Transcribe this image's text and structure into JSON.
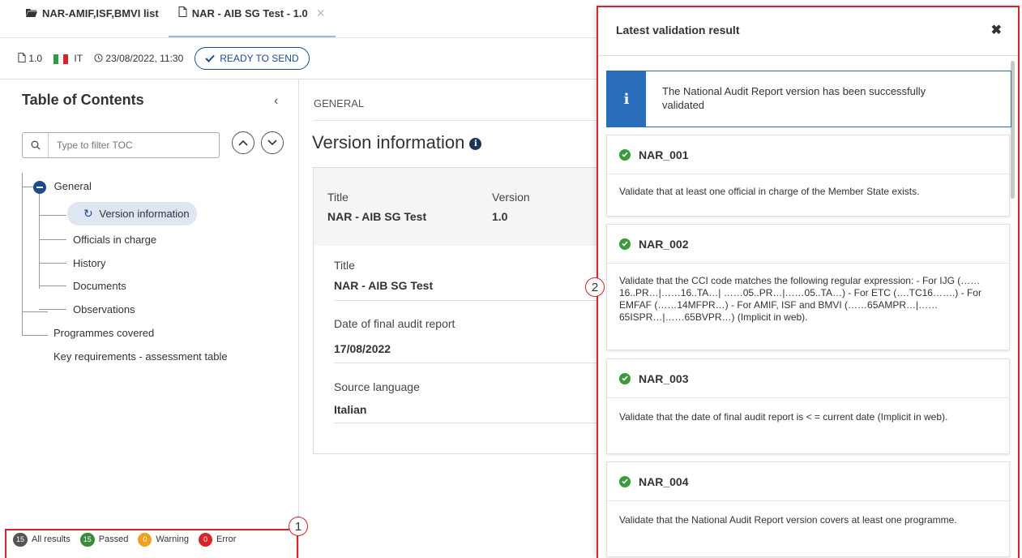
{
  "tabs": [
    {
      "label": "NAR-AMIF,ISF,BMVI list",
      "icon": "folder-icon"
    },
    {
      "label": "NAR - AIB SG Test - 1.0",
      "icon": "document-icon"
    }
  ],
  "meta": {
    "version": "1.0",
    "country": "IT",
    "datetime": "23/08/2022, 11:30",
    "status": "READY TO SEND"
  },
  "toc": {
    "title": "Table of Contents",
    "search_placeholder": "Type to filter TOC",
    "items": {
      "general": "General",
      "version_information": "Version information",
      "officials": "Officials in charge",
      "history": "History",
      "documents": "Documents",
      "observations": "Observations",
      "programmes": "Programmes covered",
      "key_requirements": "Key requirements - assessment table"
    }
  },
  "filters": {
    "all": {
      "count": "15",
      "label": "All results",
      "color": "#555555"
    },
    "passed": {
      "count": "15",
      "label": "Passed",
      "color": "#3a8a3c"
    },
    "warning": {
      "count": "0",
      "label": "Warning",
      "color": "#f0a020"
    },
    "error": {
      "count": "0",
      "label": "Error",
      "color": "#d8232a"
    }
  },
  "main": {
    "breadcrumb": "GENERAL",
    "title": "Version information",
    "head": {
      "title_label": "Title",
      "title_value": "NAR - AIB SG Test",
      "version_label": "Version",
      "version_value": "1.0"
    },
    "fields": [
      {
        "label": "Title",
        "value": "NAR - AIB SG Test"
      },
      {
        "label": "Date of final audit report",
        "value": "17/08/2022"
      },
      {
        "label": "Source language",
        "value": "Italian"
      }
    ]
  },
  "panel": {
    "title": "Latest validation result",
    "info": "The National Audit Report version has been successfully validated",
    "results": [
      {
        "code": "NAR_001",
        "text": "Validate that at least one official in charge of the Member State exists."
      },
      {
        "code": "NAR_002",
        "text": "Validate that the CCI code matches the following regular expression: - For IJG (……16..PR…|……16..TA…| ……05..PR…|……05..TA…) - For ETC (….TC16…….) - For EMFAF (……14MFPR…) - For AMIF, ISF and BMVI (……65AMPR…|……65ISPR…|……65BVPR…) (Implicit in web)."
      },
      {
        "code": "NAR_003",
        "text": "Validate that the date of final audit report is < = current date (Implicit in web)."
      },
      {
        "code": "NAR_004",
        "text": "Validate that the National Audit Report version covers at least one programme."
      }
    ]
  },
  "callouts": {
    "one": "1",
    "two": "2"
  }
}
